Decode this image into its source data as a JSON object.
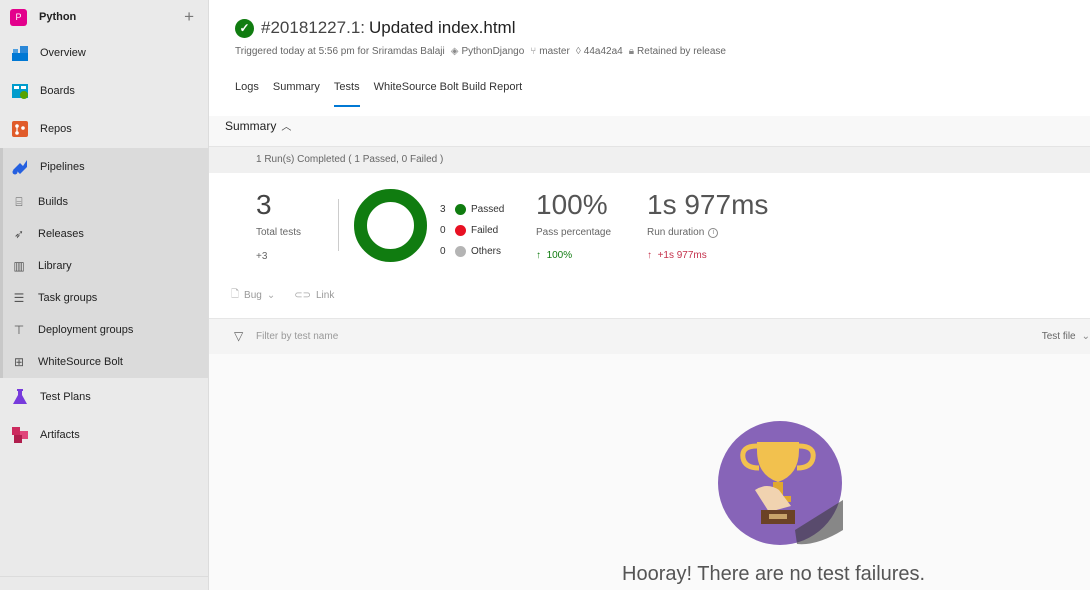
{
  "project": {
    "badge": "P",
    "name": "Python",
    "add_icon": "plus-icon"
  },
  "nav": {
    "overview": "Overview",
    "boards": "Boards",
    "repos": "Repos",
    "pipelines": "Pipelines",
    "pipelines_sub": {
      "builds": "Builds",
      "releases": "Releases",
      "library": "Library",
      "task_groups": "Task groups",
      "deployment_groups": "Deployment groups",
      "whitesource_bolt": "WhiteSource Bolt"
    },
    "test_plans": "Test Plans",
    "artifacts": "Artifacts"
  },
  "build": {
    "id": "#20181227.1:",
    "title": "Updated index.html",
    "triggered": "Triggered today at 5:56 pm for Sriramdas Balaji",
    "repo": "PythonDjango",
    "branch": "master",
    "commit": "44a42a4",
    "retained": "Retained by release"
  },
  "tabs": {
    "logs": "Logs",
    "summary": "Summary",
    "tests": "Tests",
    "whitesource": "WhiteSource Bolt Build Report"
  },
  "summary_header": "Summary",
  "run_status": "1 Run(s) Completed ( 1 Passed, 0 Failed )",
  "stats": {
    "total": "3",
    "total_label": "Total tests",
    "total_delta": "+3",
    "passed_count": "3",
    "passed_label": "Passed",
    "failed_count": "0",
    "failed_label": "Failed",
    "others_count": "0",
    "others_label": "Others",
    "pass_pct": "100%",
    "pass_pct_label": "Pass percentage",
    "pass_pct_delta": "100%",
    "duration": "1s 977ms",
    "duration_label": "Run duration",
    "duration_delta": "+1s 977ms",
    "passed_fraction": 1.0
  },
  "colors": {
    "passed": "#107c10",
    "failed": "#e81123",
    "others": "#b4b4b4",
    "accent": "#0078d4"
  },
  "actions": {
    "bug": "Bug",
    "link": "Link"
  },
  "filter": {
    "placeholder": "Filter by test name",
    "group_by": "Test file"
  },
  "empty_message": "Hooray! There are no test failures."
}
